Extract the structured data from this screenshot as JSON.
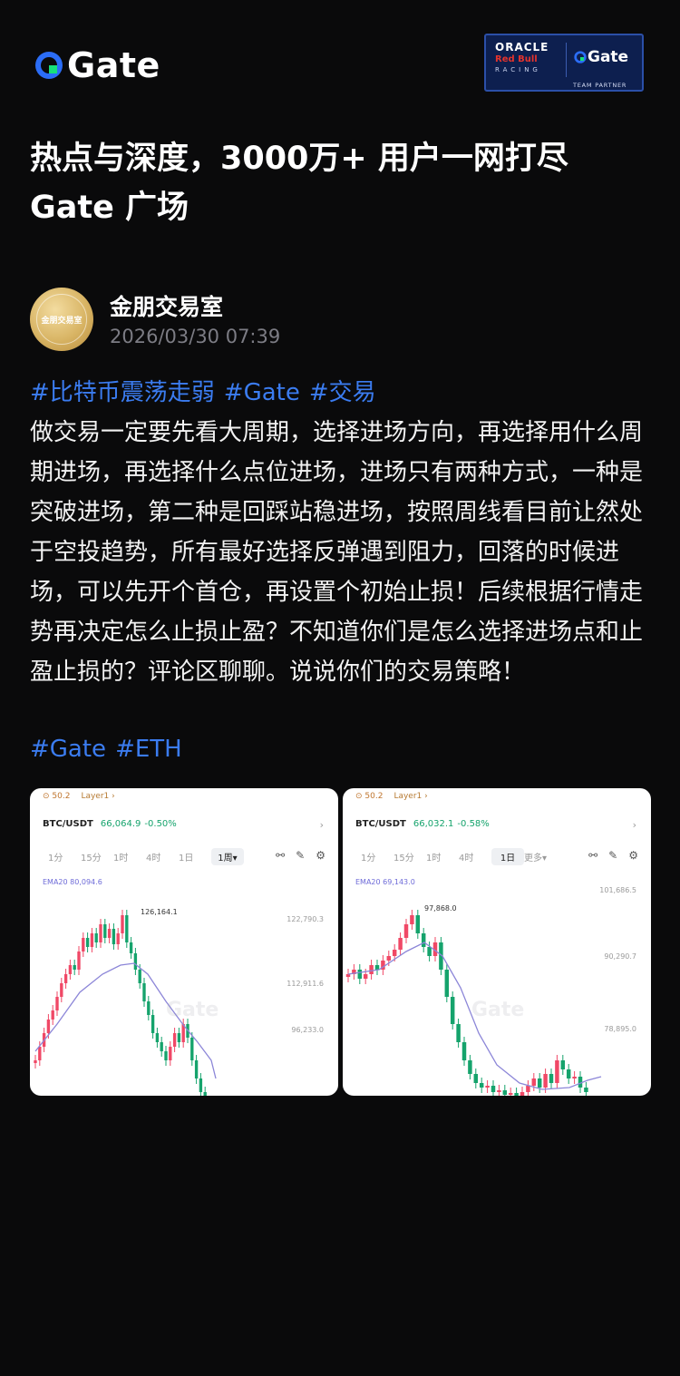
{
  "header": {
    "logo_text": "Gate",
    "partner": {
      "oracle": "ORACLE",
      "redbull": "Red Bull",
      "racing": "RACING",
      "gate": "Gate",
      "tag": "TEAM PARTNER"
    }
  },
  "headline": {
    "line1": "热点与深度，3000万+ 用户一网打尽",
    "line2": "Gate 广场"
  },
  "post": {
    "author": {
      "name": "金朋交易室",
      "time": "2026/03/30 07:39",
      "avatar_text": "金朋交易室"
    },
    "tags_top": [
      "#比特币震荡走弱",
      "#Gate",
      "#交易"
    ],
    "body": "做交易一定要先看大周期，选择进场方向，再选择用什么周期进场，再选择什么点位进场，进场只有两种方式，一种是突破进场，第二种是回踩站稳进场，按照周线看目前让然处于空投趋势，所有最好选择反弹遇到阻力，回落的时候进场，可以先开个首仓，再设置个初始止损！后续根据行情走势再决定怎么止损止盈？不知道你们是怎么选择进场点和止盈止损的？评论区聊聊。说说你们的交易策略！",
    "tags_bottom": [
      "#Gate",
      "#ETH"
    ]
  },
  "images": [
    {
      "top_left": "⊙ 50.2",
      "top_layer": "Layer1 ›",
      "pair": "BTC/USDT",
      "price": "66,064.9",
      "change": "-0.50%",
      "intervals": [
        "1分",
        "15分",
        "1时",
        "4时",
        "1日",
        "1周▾"
      ],
      "selected": "1周▾",
      "ema": "EMA20 80,094.6",
      "levels": [
        "122,790.3",
        "112,911.6",
        "96,233.0"
      ],
      "high": "126,164.1",
      "watermark": "Gate"
    },
    {
      "top_left": "⊙ 50.2",
      "top_layer": "Layer1 ›",
      "pair": "BTC/USDT",
      "price": "66,032.1",
      "change": "-0.58%",
      "intervals": [
        "1分",
        "15分",
        "1时",
        "4时",
        "1日",
        "更多▾"
      ],
      "selected": "1日",
      "ema": "EMA20 69,143.0",
      "levels": [
        "101,686.5",
        "90,290.7",
        "78,895.0"
      ],
      "high": "97,868.0",
      "watermark": "Gate"
    }
  ],
  "colors": {
    "background": "#0a0a0b",
    "accent_blue": "#3b7cf0",
    "gate_green": "#17e07a",
    "candle_up": "#15a36c",
    "candle_down": "#f04866",
    "ema": "#8c86d8"
  }
}
